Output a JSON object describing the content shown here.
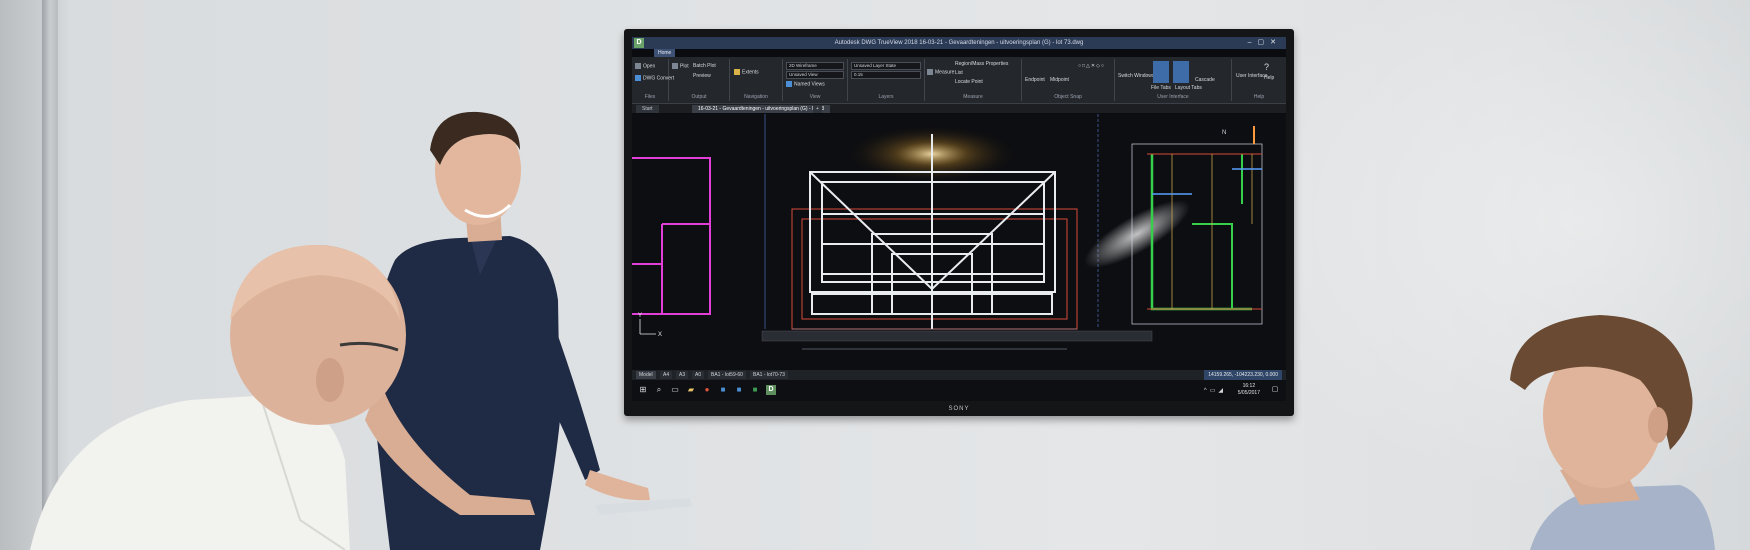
{
  "scene": {
    "description_colors": {
      "wall": "#dcdfe1",
      "tv_frame": "#141516",
      "canvas": "#0d0e12"
    }
  },
  "tv": {
    "brand": "SONY",
    "app": {
      "title": "Autodesk DWG TrueView 2018   16-03-21 - Gevaardteningen - uitvoeringsplan (G) - lot 73.dwg",
      "home_tab": "Home",
      "ribbon": {
        "files": {
          "label": "Files",
          "open": "Open",
          "dwg_convert": "DWG Convert"
        },
        "output": {
          "label": "Output",
          "plot": "Plot",
          "batch_plot": "Batch Plot",
          "preview": "Preview"
        },
        "navigation": {
          "label": "Navigation",
          "extents": "Extents"
        },
        "view": {
          "label": "View",
          "visual_style": "2D Wireframe",
          "saved_view": "Unsaved View",
          "named_views": "Named Views"
        },
        "layers": {
          "label": "Layers",
          "layer_state": "Unsaved Layer State",
          "lineweight": "0.15"
        },
        "measure": {
          "label": "Measure",
          "measure": "Measure",
          "region": "Region/Mass Properties",
          "list": "List",
          "locate": "Locate Point"
        },
        "object_snap": {
          "label": "Object Snap",
          "endpoint": "Endpoint",
          "midpoint": "Midpoint"
        },
        "user_interface": {
          "label": "User Interface",
          "switch_windows": "Switch Windows",
          "file_tabs": "File Tabs",
          "layout_tabs": "Layout Tabs",
          "cascade": "Cascade"
        },
        "help": {
          "label": "Help",
          "user_interface": "User Interface",
          "help": "Help"
        }
      },
      "doc_tabs": [
        "Start",
        "16-03-21 - Gevaardteningen - uitvoeringsplan (G) - lot 73"
      ],
      "layout_tabs": [
        "Model",
        "A4",
        "A3",
        "A0",
        "BA1 - lot59-60",
        "BA1 - lot70-73"
      ],
      "coordinates": "14159.265, -104223.230, 0.000"
    },
    "taskbar": {
      "time": "16:12",
      "date": "5/05/2017"
    }
  }
}
